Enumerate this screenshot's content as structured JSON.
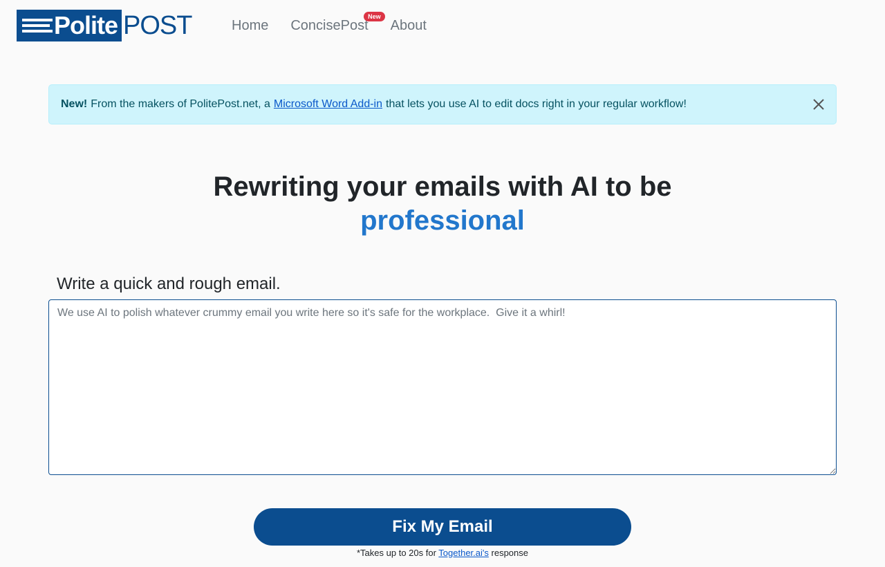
{
  "brand": {
    "name_part1": "Polite",
    "name_part2": "POST",
    "primary_color": "#0b4d8f",
    "accent_color": "#2277cc"
  },
  "nav": {
    "items": [
      {
        "label": "Home"
      },
      {
        "label": "ConcisePost",
        "badge": "New"
      },
      {
        "label": "About"
      }
    ]
  },
  "alert": {
    "strong": "New!",
    "text_before": "From the makers of PolitePost.net, a",
    "link": "Microsoft Word Add-in",
    "text_after": "that lets you use AI to edit docs right in your regular workflow!",
    "close_icon": "close-icon"
  },
  "hero": {
    "title": "Rewriting your emails with AI to be",
    "accent": "professional"
  },
  "form": {
    "label": "Write a quick and rough email.",
    "placeholder": "We use AI to polish whatever crummy email you write here so it's safe for the workplace.  Give it a whirl!",
    "value": "",
    "button_label": "Fix My Email"
  },
  "footnote": {
    "before": "*Takes up to 20s for",
    "link": "Together.ai's",
    "after": "response"
  }
}
